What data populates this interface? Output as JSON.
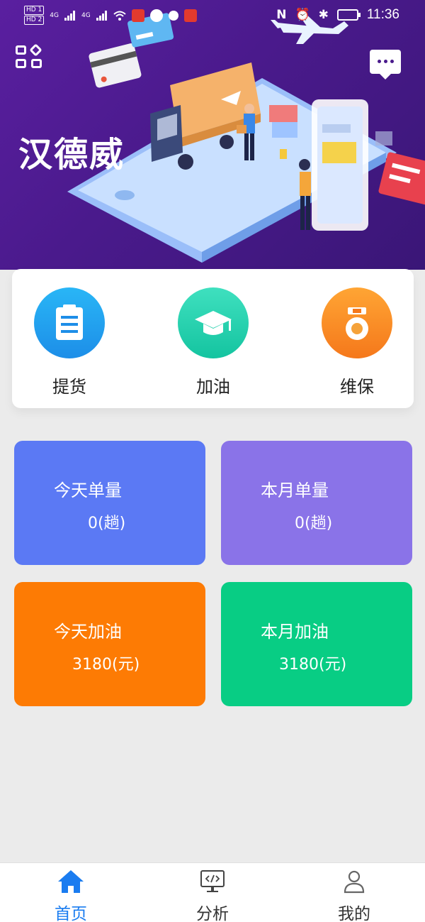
{
  "status_bar": {
    "time": "11:36",
    "left_badges": [
      "HD 1",
      "HD 2"
    ],
    "signal_labels": [
      "4G",
      "4G"
    ]
  },
  "header": {
    "title": "汉德威",
    "apps_icon": "apps-grid-icon",
    "message_icon": "chat-bubble-icon"
  },
  "actions": [
    {
      "label": "提货",
      "icon": "clipboard-icon",
      "color": "#1d8ee8"
    },
    {
      "label": "加油",
      "icon": "graduation-cap-icon",
      "color": "#14c4a0"
    },
    {
      "label": "维保",
      "icon": "medal-icon",
      "color": "#f5781b"
    }
  ],
  "stats": [
    {
      "title": "今天单量",
      "value": "0(趟)",
      "color": "#5b79f4"
    },
    {
      "title": "本月单量",
      "value": "0(趟)",
      "color": "#8a73e8"
    },
    {
      "title": "今天加油",
      "value": "3180(元)",
      "color": "#fd7b04"
    },
    {
      "title": "本月加油",
      "value": "3180(元)",
      "color": "#08cd84"
    }
  ],
  "bottom_nav": [
    {
      "label": "首页",
      "icon": "home-icon",
      "active": true
    },
    {
      "label": "分析",
      "icon": "monitor-code-icon",
      "active": false
    },
    {
      "label": "我的",
      "icon": "user-icon",
      "active": false
    }
  ],
  "colors": {
    "accent": "#1a7cf0",
    "banner": "#4a1a8c",
    "background": "#ebebeb"
  }
}
